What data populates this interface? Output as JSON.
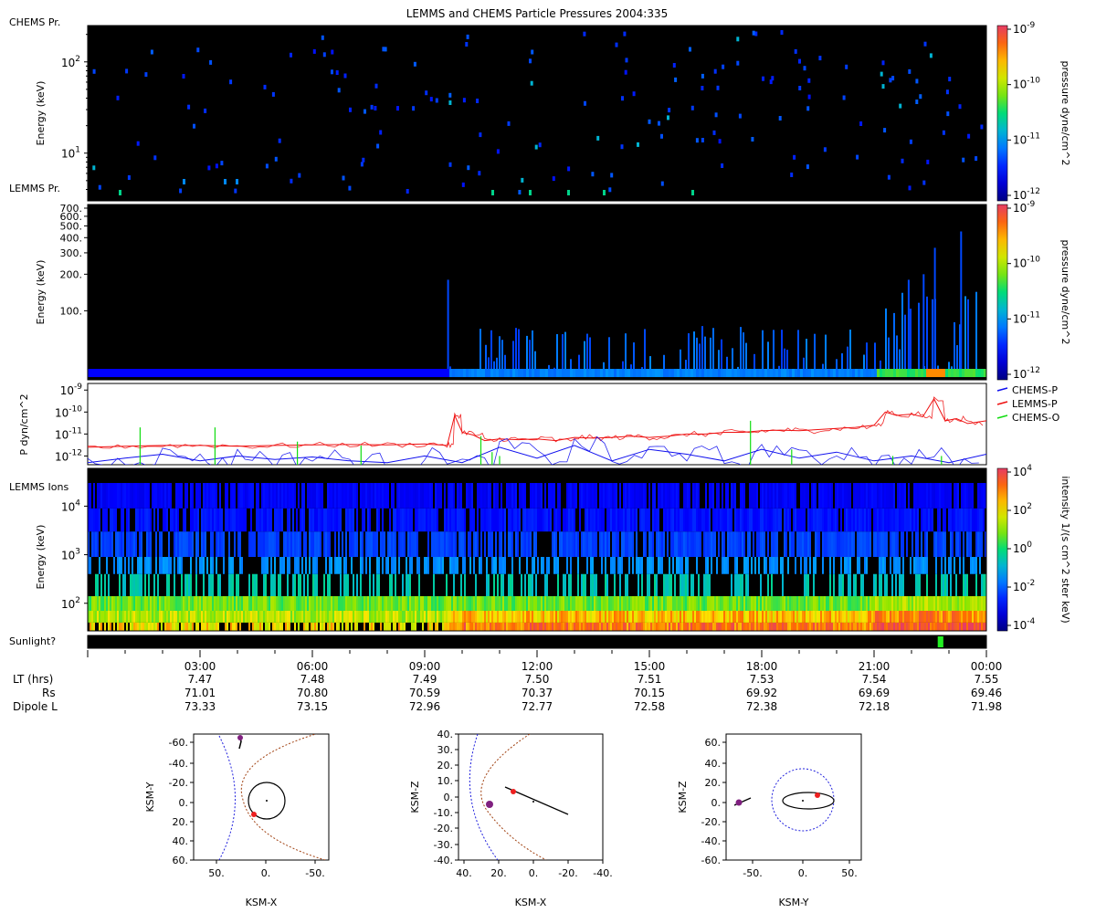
{
  "title": "LEMMS and CHEMS Particle Pressures  2004:335",
  "colors": {
    "chems_p": "#1010ee",
    "lemms_p": "#ee1010",
    "chems_o": "#10dd10",
    "sunlight": "#22ee22",
    "bow_shock": "#2020dd",
    "magnetopause": "#a04010",
    "spacecraft": "#ee2020",
    "trajectory": "#000000"
  },
  "panels": {
    "chems": {
      "label": "CHEMS Pr.",
      "ylabel": "Energy (keV)",
      "yticks": [
        {
          "v": 10,
          "label": "10",
          "exp": "1"
        },
        {
          "v": 100,
          "label": "10",
          "exp": "2"
        }
      ],
      "colorbar": {
        "label": "pressure dyne/cm^2",
        "ticks": [
          {
            "exp": "-9",
            "label": "10"
          },
          {
            "exp": "-10",
            "label": "10"
          },
          {
            "exp": "-11",
            "label": "10"
          },
          {
            "exp": "-12",
            "label": "10"
          }
        ]
      }
    },
    "lemms": {
      "label": "LEMMS Pr.",
      "ylabel": "Energy (keV)",
      "yticks": [
        "100.",
        "200.",
        "300.",
        "400.",
        "500.",
        "600.",
        "700."
      ],
      "colorbar": {
        "label": "pressure dyne/cm^2",
        "ticks": [
          {
            "exp": "-9",
            "label": "10"
          },
          {
            "exp": "-10",
            "label": "10"
          },
          {
            "exp": "-11",
            "label": "10"
          },
          {
            "exp": "-12",
            "label": "10"
          }
        ]
      }
    },
    "pressure": {
      "ylabel": "P dyn/cm^2",
      "yticks": [
        {
          "label": "10",
          "exp": "-9"
        },
        {
          "label": "10",
          "exp": "-10"
        },
        {
          "label": "10",
          "exp": "-11"
        },
        {
          "label": "10",
          "exp": "-12"
        }
      ],
      "legend": [
        "CHEMS-P",
        "LEMMS-P",
        "CHEMS-O"
      ]
    },
    "ions": {
      "label": "LEMMS Ions",
      "ylabel": "Energy (keV)",
      "yticks": [
        {
          "label": "10",
          "exp": "2"
        },
        {
          "label": "10",
          "exp": "3"
        },
        {
          "label": "10",
          "exp": "4"
        }
      ],
      "colorbar": {
        "label": "intensity 1/(s cm^2 ster keV)",
        "ticks": [
          {
            "label": "10",
            "exp": "4"
          },
          {
            "label": "10",
            "exp": "2"
          },
          {
            "label": "10",
            "exp": "0"
          },
          {
            "label": "10",
            "exp": "-2"
          },
          {
            "label": "10",
            "exp": "-4"
          }
        ]
      }
    },
    "sunlight": {
      "label": "Sunlight?",
      "segments": [
        {
          "start_hr": 22.7,
          "end_hr": 22.85
        }
      ]
    }
  },
  "time_axis": {
    "range_hr": [
      0,
      24
    ],
    "labels": [
      "03:00",
      "06:00",
      "09:00",
      "12:00",
      "15:00",
      "18:00",
      "21:00",
      "00:00"
    ],
    "label_hours": [
      3,
      6,
      9,
      12,
      15,
      18,
      21,
      24
    ],
    "row_labels": [
      "LT (hrs)",
      "Rs",
      "Dipole L"
    ],
    "lt": [
      "7.47",
      "7.48",
      "7.49",
      "7.50",
      "7.51",
      "7.53",
      "7.54",
      "7.55"
    ],
    "rs": [
      "71.01",
      "70.80",
      "70.59",
      "70.37",
      "70.15",
      "69.92",
      "69.69",
      "69.46"
    ],
    "dipole_l": [
      "73.33",
      "73.15",
      "72.96",
      "72.77",
      "72.58",
      "72.38",
      "72.18",
      "71.98"
    ]
  },
  "chart_data": {
    "type": "line",
    "title": "LEMMS and CHEMS Particle Pressures  2004:335",
    "xlabel": "",
    "ylabel": "P dyn/cm^2",
    "yscale": "log",
    "ylim": [
      4e-13,
      2e-09
    ],
    "xlim_hr": [
      0,
      24
    ],
    "series": [
      {
        "name": "LEMMS-P",
        "x": [
          0,
          1,
          2,
          3,
          4,
          5,
          6,
          7,
          8,
          9,
          9.6,
          9.8,
          10,
          10.3,
          10.6,
          11,
          11.5,
          12,
          12.5,
          13,
          13.5,
          14,
          14.5,
          15,
          15.5,
          16,
          16.5,
          17,
          17.5,
          18,
          18.5,
          19,
          19.5,
          20,
          20.5,
          21,
          21.3,
          21.6,
          22,
          22.3,
          22.6,
          22.9,
          23.2,
          23.5,
          24
        ],
        "y": [
          2.5e-12,
          2.8e-12,
          3e-12,
          3e-12,
          2.8e-12,
          3e-12,
          3.2e-12,
          3.3e-12,
          3.2e-12,
          3.5e-12,
          3e-12,
          7e-11,
          1.2e-11,
          9e-12,
          5e-12,
          6e-12,
          5.5e-12,
          6e-12,
          5e-12,
          7e-12,
          6.5e-12,
          7e-12,
          8e-12,
          7e-12,
          8e-12,
          1e-11,
          1e-11,
          1.2e-11,
          1.2e-11,
          1.4e-11,
          1.5e-11,
          1.4e-11,
          1.6e-11,
          1.8e-11,
          2e-11,
          2.5e-11,
          1e-10,
          7e-11,
          8e-11,
          6e-11,
          4e-10,
          4e-11,
          5e-11,
          3e-11,
          4e-11
        ]
      },
      {
        "name": "CHEMS-P",
        "x": [
          0,
          1,
          2,
          3,
          4,
          5,
          6,
          7,
          8,
          9,
          10,
          11,
          12,
          13,
          14,
          15,
          16,
          17,
          18,
          19,
          20,
          21,
          22,
          23,
          24
        ],
        "y": [
          5e-13,
          8e-13,
          1.2e-12,
          6e-13,
          1e-12,
          7e-13,
          9e-13,
          6e-13,
          5e-13,
          1e-12,
          5e-13,
          2.5e-12,
          8e-13,
          3e-12,
          6e-13,
          2e-12,
          1.2e-12,
          6e-13,
          2e-12,
          8e-13,
          1.5e-12,
          6e-13,
          1e-12,
          5e-13,
          1.2e-12
        ]
      },
      {
        "name": "CHEMS-O",
        "x": [
          1.4,
          3.4,
          5.6,
          7.3,
          10.5,
          10.8,
          11,
          17.7,
          18.8,
          21.5,
          22.8
        ],
        "y": [
          2e-11,
          2e-11,
          4.5e-12,
          3e-12,
          8e-12,
          1.5e-12,
          1e-12,
          4e-11,
          2e-12,
          1e-12,
          1e-12
        ]
      }
    ],
    "spectrograms": [
      {
        "name": "CHEMS Pr.",
        "yscale": "log",
        "ylim": [
          3,
          250
        ],
        "zscale": "log",
        "zlim": [
          1e-12,
          1e-09
        ]
      },
      {
        "name": "LEMMS Pr.",
        "yscale": "log",
        "ylim": [
          27,
          750
        ],
        "zscale": "log",
        "zlim": [
          1e-12,
          1e-09
        ]
      },
      {
        "name": "LEMMS Ions",
        "yscale": "log",
        "ylim": [
          27,
          60000
        ],
        "zscale": "log",
        "zlim": [
          0.0001,
          10000.0
        ]
      }
    ],
    "orbit_plots": [
      {
        "xlabel": "KSM-X",
        "ylabel": "KSM-Y",
        "xticks": [
          "50.",
          "0.",
          "-50."
        ],
        "yticks": [
          "-60.",
          "-40.",
          "-20.",
          "0.",
          "20.",
          "40.",
          "60."
        ]
      },
      {
        "xlabel": "KSM-X",
        "ylabel": "KSM-Z",
        "xticks": [
          "40.",
          "20.",
          "0.",
          "-20.",
          "-40."
        ],
        "yticks": [
          "40.",
          "30.",
          "20.",
          "10.",
          "0.",
          "-10.",
          "-20.",
          "-30.",
          "-40."
        ]
      },
      {
        "xlabel": "KSM-Y",
        "ylabel": "KSM-Z",
        "xticks": [
          "-50.",
          "0.",
          "50."
        ],
        "yticks": [
          "60.",
          "40.",
          "20.",
          "0.",
          "-20.",
          "-40.",
          "-60."
        ]
      }
    ]
  }
}
